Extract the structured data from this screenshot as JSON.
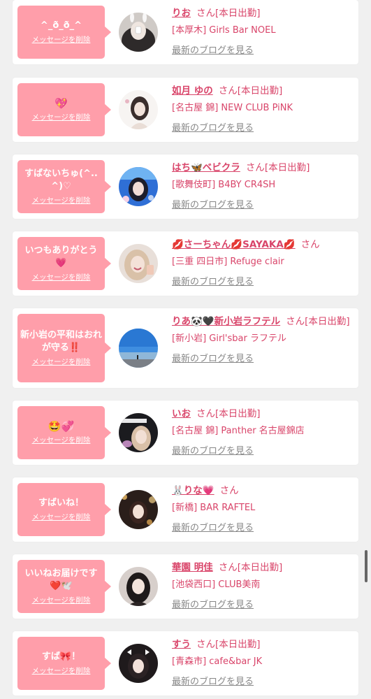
{
  "colors": {
    "accent": "#d9456a",
    "bubble": "#ff9eaa",
    "blog_link": "#888888",
    "background": "#f0f0f0"
  },
  "delete_label": "メッセージを削除",
  "blog_label": "最新のブログを見る",
  "honorific": "さん",
  "items": [
    {
      "message": "^_ð_ð_^",
      "name": "りお",
      "status": "[本日出勤]",
      "shop": "[本厚木] Girls Bar NOEL",
      "avatar_icon": "girl-with-bunny-filter-avatar"
    },
    {
      "message": "💖",
      "name": "如月 ゆの",
      "status": "[本日出勤]",
      "shop": "[名古屋 錦] NEW CLUB PiNK",
      "avatar_icon": "girl-portrait-avatar"
    },
    {
      "message": "すばないちゅ(^..^)♡",
      "name": "はち🦋ベビクラ",
      "status": "[本日出勤]",
      "shop": "[歌舞伎町] B4BY CR4SH",
      "avatar_icon": "girl-blue-background-avatar"
    },
    {
      "message": "いつもありがとう💗",
      "name": "💋さーちゃん💋SAYAKA💋",
      "status": "",
      "shop": "[三重 四日市] Refuge clair",
      "avatar_icon": "girl-selfie-avatar"
    },
    {
      "message": "新小岩の平和はおれが守る‼️",
      "name": "りあ🐼🖤新小岩ラフテル",
      "status": "[本日出勤]",
      "shop": "[新小岩] Girl'sbar ラフテル",
      "avatar_icon": "seaside-sky-avatar"
    },
    {
      "message": "🤩💞",
      "name": "いお",
      "status": "[本日出勤]",
      "shop": "[名古屋 錦] Panther 名古屋錦店",
      "avatar_icon": "panther-logo-girl-avatar"
    },
    {
      "message": "すばいね！",
      "name": "🐰りな💗",
      "status": "",
      "shop": "[新橋] BAR RAFTEL",
      "avatar_icon": "girl-bokeh-avatar"
    },
    {
      "message": "いいねお届けです❤️🕊️",
      "name": "華園 明佳",
      "status": "[本日出勤]",
      "shop": "[池袋西口] CLUB美南",
      "avatar_icon": "girl-dark-hair-avatar"
    },
    {
      "message": "すば🎀！",
      "name": "すう",
      "status": "[本日出勤]",
      "shop": "[青森市] cafe&bar JK",
      "avatar_icon": "girl-twin-ribbons-avatar"
    }
  ]
}
